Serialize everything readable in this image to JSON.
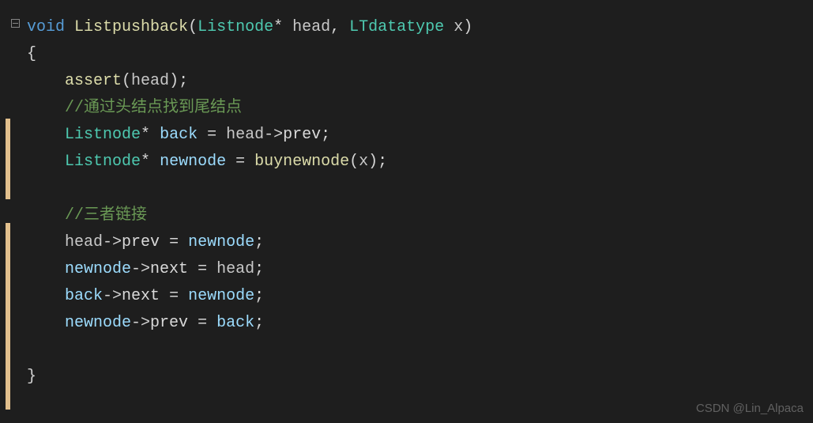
{
  "code": {
    "keyword_void": "void",
    "fn_name": "Listpushback",
    "type_listnode": "Listnode",
    "param_head": "head",
    "type_lt": "LTdatatype",
    "param_x": "x",
    "brace_open": "{",
    "brace_close": "}",
    "assert_fn": "assert",
    "assert_arg": "head",
    "comment1": "//通过头结点找到尾结点",
    "var_back": "back",
    "eq": " = ",
    "head_prev": "head",
    "arrow": "->",
    "prev_member": "prev",
    "semi": ";",
    "var_newnode": "newnode",
    "buynewnode_fn": "buynewnode",
    "buy_arg": "x",
    "comment2": "//三者链接",
    "head_var": "head",
    "newnode_var": "newnode",
    "next_member": "next",
    "back_var": "back",
    "star": "*",
    "paren_open": "(",
    "paren_close": ")",
    "comma_space": ", ",
    "space": " "
  },
  "watermark": "CSDN @Lin_Alpaca"
}
